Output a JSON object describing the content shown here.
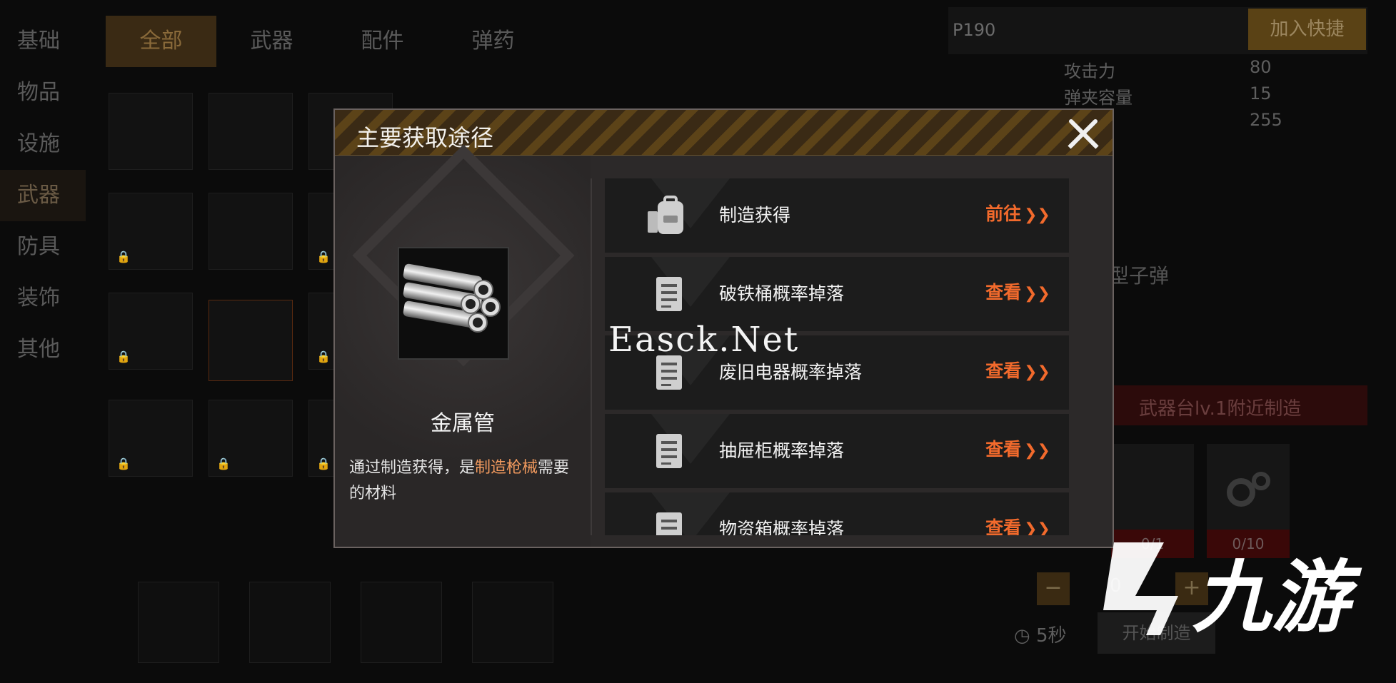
{
  "left_nav": [
    "基础",
    "物品",
    "设施",
    "武器",
    "防具",
    "装饰",
    "其他"
  ],
  "left_nav_active": 3,
  "top_tabs": [
    "全部",
    "武器",
    "配件",
    "弹药"
  ],
  "top_tabs_active": 0,
  "right_panel": {
    "item_name": "P190",
    "quick_add_label": "加入快捷",
    "stats": [
      {
        "label": "攻击力",
        "value": "80"
      },
      {
        "label": "弹夹容量",
        "value": "15"
      },
      {
        "label": "",
        "value": "255"
      }
    ],
    "ammo_type_partial": "型子弹",
    "craft_location_partial": "武器台lv.1附近制造",
    "materials": [
      {
        "count": "0/1"
      },
      {
        "count": "0/10"
      }
    ],
    "qty_minus": "−",
    "qty_plus": "+",
    "qty_value": "0",
    "craft_time": "5秒",
    "craft_button_partial": "开始制造"
  },
  "modal": {
    "title": "主要获取途径",
    "item": {
      "name": "金属管",
      "desc_prefix": "通过制造获得，是",
      "desc_highlight": "制造枪械",
      "desc_suffix": "需要的材料"
    },
    "sources": [
      {
        "label": "制造获得",
        "action": "前往",
        "icon": "backpack-icon"
      },
      {
        "label": "破铁桶概率掉落",
        "action": "查看",
        "icon": "document-icon"
      },
      {
        "label": "废旧电器概率掉落",
        "action": "查看",
        "icon": "document-icon"
      },
      {
        "label": "抽屉柜概率掉落",
        "action": "查看",
        "icon": "document-icon"
      },
      {
        "label": "物资箱概率掉落",
        "action": "查看",
        "icon": "document-icon"
      }
    ]
  },
  "watermark_text": "Easck.Net",
  "watermark_logo": "九游",
  "colors": {
    "accent_orange": "#f26a2c",
    "highlight": "#f29a5e",
    "modal_bg": "#2c2929"
  }
}
